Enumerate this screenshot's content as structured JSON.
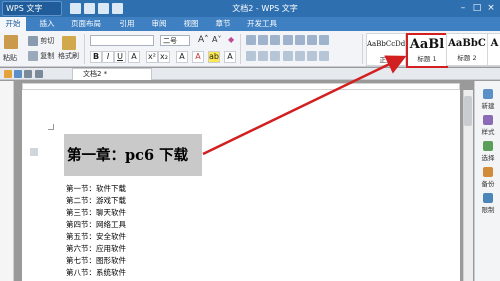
{
  "title_bar": {
    "app_button": "WPS 文字",
    "doc_title": "文档2 - WPS 文字",
    "window_controls": [
      "–",
      "□",
      "×"
    ]
  },
  "menu": [
    "开始",
    "插入",
    "页面布局",
    "引用",
    "审阅",
    "视图",
    "章节",
    "开发工具"
  ],
  "ribbon": {
    "cut": "剪切",
    "copy": "复制",
    "format_painter": "格式刷",
    "paste": "粘贴",
    "font_size": "二号",
    "styles": [
      {
        "sample": "AaBbCcDd",
        "label": "正文"
      },
      {
        "sample": "AaBl",
        "label": "标题 1"
      },
      {
        "sample": "AaBbC",
        "label": "标题 2"
      },
      {
        "sample": "AaBbC",
        "label": "A"
      }
    ]
  },
  "doc_tab": "文档2 *",
  "document": {
    "heading": "第一章：pc6 下载",
    "toc": [
      "第一节：软件下载",
      "第二节：游戏下载",
      "第三节：聊天软件",
      "第四节：网络工具",
      "第五节：安全软件",
      "第六节：应用软件",
      "第七节：图形软件",
      "第八节：系统软件"
    ]
  },
  "right_panel": [
    "新建",
    "样式",
    "选择",
    "备份",
    "限制"
  ],
  "colors": {
    "title_bar": "#2e6fb0",
    "menu_bar": "#3f80c2",
    "highlight_box": "#d21f1f",
    "arrow": "#d21f1f",
    "heading_shade": "#c9c9c9"
  }
}
